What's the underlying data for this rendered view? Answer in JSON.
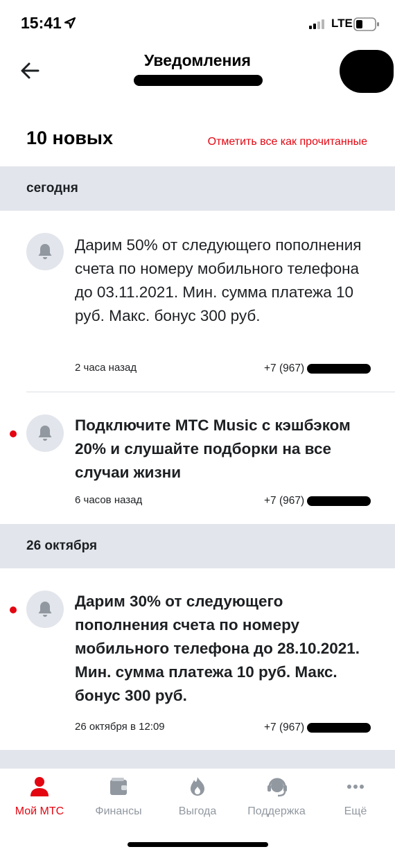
{
  "status_bar": {
    "time": "15:41",
    "network": "LTE",
    "icons": [
      "location-arrow-icon",
      "signal-bars-icon",
      "battery-icon"
    ]
  },
  "header": {
    "title": "Уведомления",
    "icons": [
      "back-arrow-icon"
    ]
  },
  "summary": {
    "new_count": "10 новых",
    "mark_all_label": "Отметить все как прочитанные"
  },
  "sections": [
    {
      "label": "сегодня",
      "notifications": [
        {
          "unread": false,
          "text": "Дарим 50% от следующего пополнения счета по номеру мобильного телефона до 03.11.2021. Мин. сумма платежа 10 руб. Макс. бонус 300 руб.",
          "time": "2 часа назад",
          "phone_prefix": "+7 (967)"
        },
        {
          "unread": true,
          "text": "Подключите МТС Music с кэшбэком 20% и слушайте подборки на все случаи жизни",
          "time": "6 часов назад",
          "phone_prefix": "+7 (967)"
        }
      ]
    },
    {
      "label": "26 октября",
      "notifications": [
        {
          "unread": true,
          "text": "Дарим 30% от следующего пополнения счета по номеру мобильного телефона до 28.10.2021. Мин. сумма платежа 10 руб. Макс. бонус 300 руб.",
          "time": "26 октября в 12:09",
          "phone_prefix": "+7 (967)"
        }
      ]
    }
  ],
  "tab_bar": {
    "tabs": [
      {
        "label": "Мой МТС",
        "icon": "person-icon",
        "active": true
      },
      {
        "label": "Финансы",
        "icon": "wallet-icon",
        "active": false
      },
      {
        "label": "Выгода",
        "icon": "flame-icon",
        "active": false
      },
      {
        "label": "Поддержка",
        "icon": "support-headset-icon",
        "active": false
      },
      {
        "label": "Ещё",
        "icon": "more-dots-icon",
        "active": false
      }
    ]
  },
  "colors": {
    "accent": "#e30611",
    "section_bg": "#e2e5eb",
    "inactive_icon": "#9198a0",
    "text": "#1d2023"
  }
}
